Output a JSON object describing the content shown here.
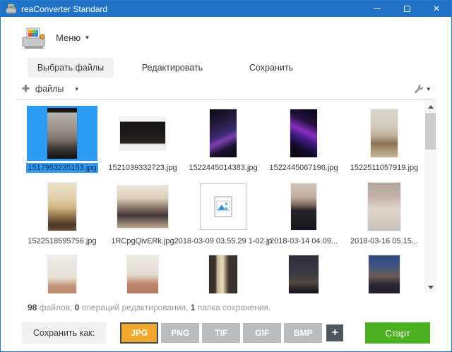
{
  "window": {
    "title": "reaConverter Standard",
    "close_glyph": "×"
  },
  "menu": {
    "label": "Меню",
    "caret": "▾"
  },
  "tabs": {
    "select_files": "Выбрать файлы",
    "edit": "Редактировать",
    "save": "Сохранить"
  },
  "toolbar": {
    "plus_glyph": "✚",
    "files_label": "файлы",
    "caret": "▾"
  },
  "grid": {
    "row1": [
      {
        "name": "1517953235153.jpg",
        "selected": true
      },
      {
        "name": "1521039332723.jpg"
      },
      {
        "name": "1522445014383.jpg"
      },
      {
        "name": "1522445067196.jpg"
      },
      {
        "name": "1522511057919.jpg"
      }
    ],
    "row2": [
      {
        "name": "1522518595756.jpg"
      },
      {
        "name": "1RCpgQivERk.jpg"
      },
      {
        "name": "2018-03-09 03.55.29 1-02.jp"
      },
      {
        "name": "2018-03-14 04.09..."
      },
      {
        "name": "2018-03-16 05.15..."
      }
    ]
  },
  "status": {
    "files_count": "98",
    "files_text": " файлов, ",
    "ops_count": "0",
    "ops_text": " операций редактирования, ",
    "save_count": "1",
    "save_text": " папка сохранения."
  },
  "footer": {
    "save_as": "Сохранить как:",
    "formats": [
      "JPG",
      "PNG",
      "TIF",
      "GIF",
      "BMP"
    ],
    "selected_format": "JPG",
    "add_glyph": "+",
    "start": "Старт"
  },
  "colors": {
    "titlebar": "#2073C7",
    "selection_blue": "#2E9BF5",
    "format_selected_orange": "#F2A72E",
    "start_green": "#4CB122"
  }
}
